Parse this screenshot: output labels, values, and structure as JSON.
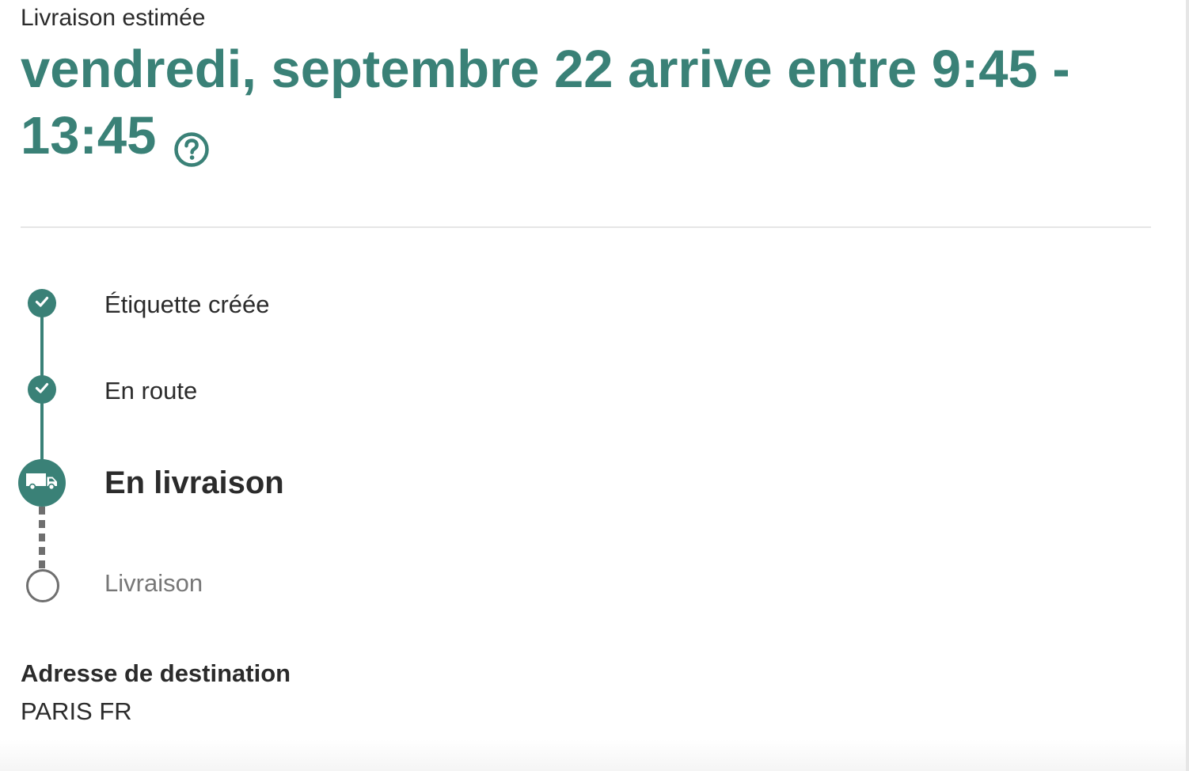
{
  "delivery": {
    "eta_label": "Livraison estimée",
    "eta_headline": "vendredi, septembre 22 arrive entre 9:45 - 13:45",
    "help_icon": "question-circle-icon"
  },
  "timeline": {
    "steps": [
      {
        "label": "Étiquette créée",
        "status": "done",
        "icon": "check-icon"
      },
      {
        "label": "En route",
        "status": "done",
        "icon": "check-icon"
      },
      {
        "label": "En livraison",
        "status": "current",
        "icon": "truck-icon"
      },
      {
        "label": "Livraison",
        "status": "pending",
        "icon": "empty-circle-icon"
      }
    ]
  },
  "destination": {
    "heading": "Adresse de destination",
    "value": "PARIS FR"
  },
  "colors": {
    "accent": "#3a8177",
    "text": "#2b2b2b",
    "muted": "#777777",
    "pending_node": "#6f6f6f",
    "divider": "#e6e6e6"
  }
}
